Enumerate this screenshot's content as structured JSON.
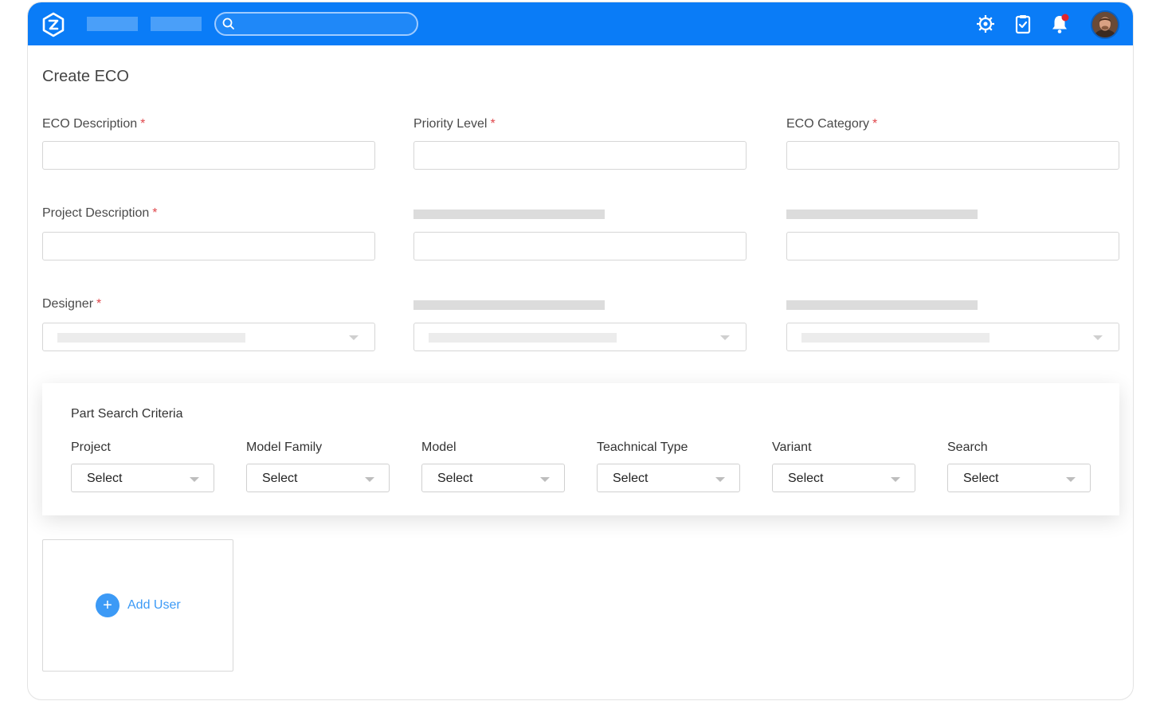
{
  "header": {
    "search": {
      "value": "",
      "placeholder": ""
    },
    "icons": [
      "gear-icon",
      "clipboard-check-icon",
      "bell-icon"
    ],
    "accent_color": "#0a7cf7",
    "notification_dot_color": "#e0242b"
  },
  "page": {
    "title": "Create ECO"
  },
  "form": {
    "eco_description": {
      "label": "ECO Description",
      "value": ""
    },
    "priority_level": {
      "label": "Priority Level",
      "value": ""
    },
    "eco_category": {
      "label": "ECO Category",
      "value": ""
    },
    "project_description": {
      "label": "Project Description",
      "value": ""
    },
    "designer": {
      "label": "Designer"
    },
    "required_marker": "*"
  },
  "part_search": {
    "title": "Part Search Criteria",
    "criteria": [
      {
        "label": "Project",
        "value": "Select"
      },
      {
        "label": "Model Family",
        "value": "Select"
      },
      {
        "label": "Model",
        "value": "Select"
      },
      {
        "label": "Teachnical Type",
        "value": "Select"
      },
      {
        "label": "Variant",
        "value": "Select"
      },
      {
        "label": "Search",
        "value": "Select"
      }
    ]
  },
  "users": {
    "add_label": "Add User",
    "add_icon": "plus-icon"
  }
}
